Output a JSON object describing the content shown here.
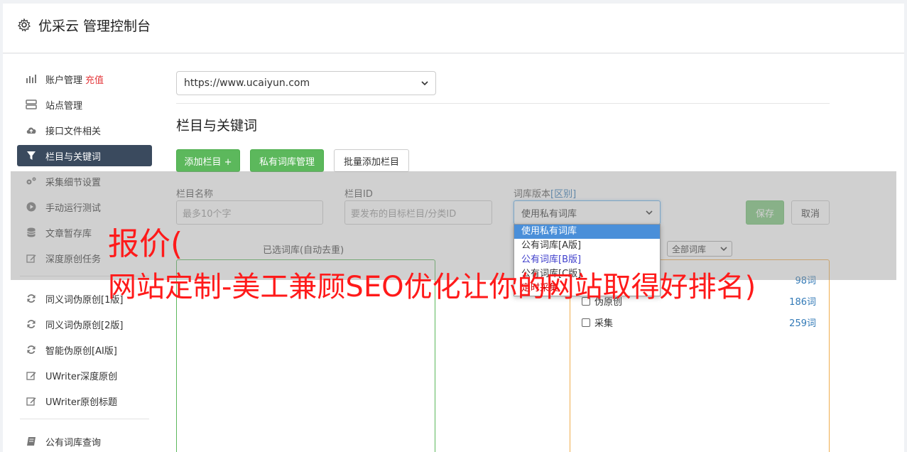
{
  "header": {
    "title": "优采云 管理控制台"
  },
  "sidebar": {
    "items": [
      {
        "label": "账户管理",
        "badge": "充值",
        "icon": "bar-chart-icon"
      },
      {
        "label": "站点管理",
        "icon": "server-icon"
      },
      {
        "label": "接口文件相关",
        "icon": "cloud-upload-icon"
      },
      {
        "label": "栏目与关键词",
        "icon": "filter-icon",
        "active": true
      },
      {
        "label": "采集细节设置",
        "icon": "gears-icon"
      },
      {
        "label": "手动运行测试",
        "icon": "play-icon"
      },
      {
        "label": "文章暂存库",
        "icon": "database-icon"
      },
      {
        "label": "深度原创任务",
        "icon": "edit-icon"
      },
      {
        "label": "同义词伪原创[1版]",
        "icon": "refresh-icon"
      },
      {
        "label": "同义词伪原创[2版]",
        "icon": "refresh-icon"
      },
      {
        "label": "智能伪原创[AI版]",
        "icon": "refresh-icon"
      },
      {
        "label": "UWriter深度原创",
        "icon": "edit-icon"
      },
      {
        "label": "UWriter原创标题",
        "icon": "edit-icon"
      },
      {
        "label": "公有词库查询",
        "icon": "book-icon"
      }
    ]
  },
  "main": {
    "site_select": "https://www.ucaiyun.com",
    "section_title": "栏目与关键词",
    "buttons": {
      "add_column": "添加栏目 +",
      "private_lib": "私有词库管理",
      "batch_add": "批量添加栏目",
      "save": "保存",
      "cancel": "取消"
    },
    "form": {
      "column_name_label": "栏目名称",
      "column_name_placeholder": "最多10个字",
      "column_id_label": "栏目ID",
      "column_id_placeholder": "要发布的目标栏目/分类ID",
      "lib_version_label": "词库版本",
      "lib_version_link": "[区别]",
      "lib_version_value": "使用私有词库"
    },
    "lib_version_options": [
      "使用私有词库",
      "公有词库[A版]",
      "公有词库[B版]",
      "公有词库[C版]",
      "定时采集"
    ],
    "selected_lib_title": "已选词库(自动去重)",
    "lib_filter": "全部词库",
    "libs": [
      {
        "name": "",
        "count": "98词"
      },
      {
        "name": "伪原创",
        "count": "186词"
      },
      {
        "name": "采集",
        "count": "259词"
      }
    ]
  },
  "watermark": {
    "line1": "报价(",
    "line2": "网站定制-美工兼顾SEO优化让你的网站取得好排名)"
  }
}
